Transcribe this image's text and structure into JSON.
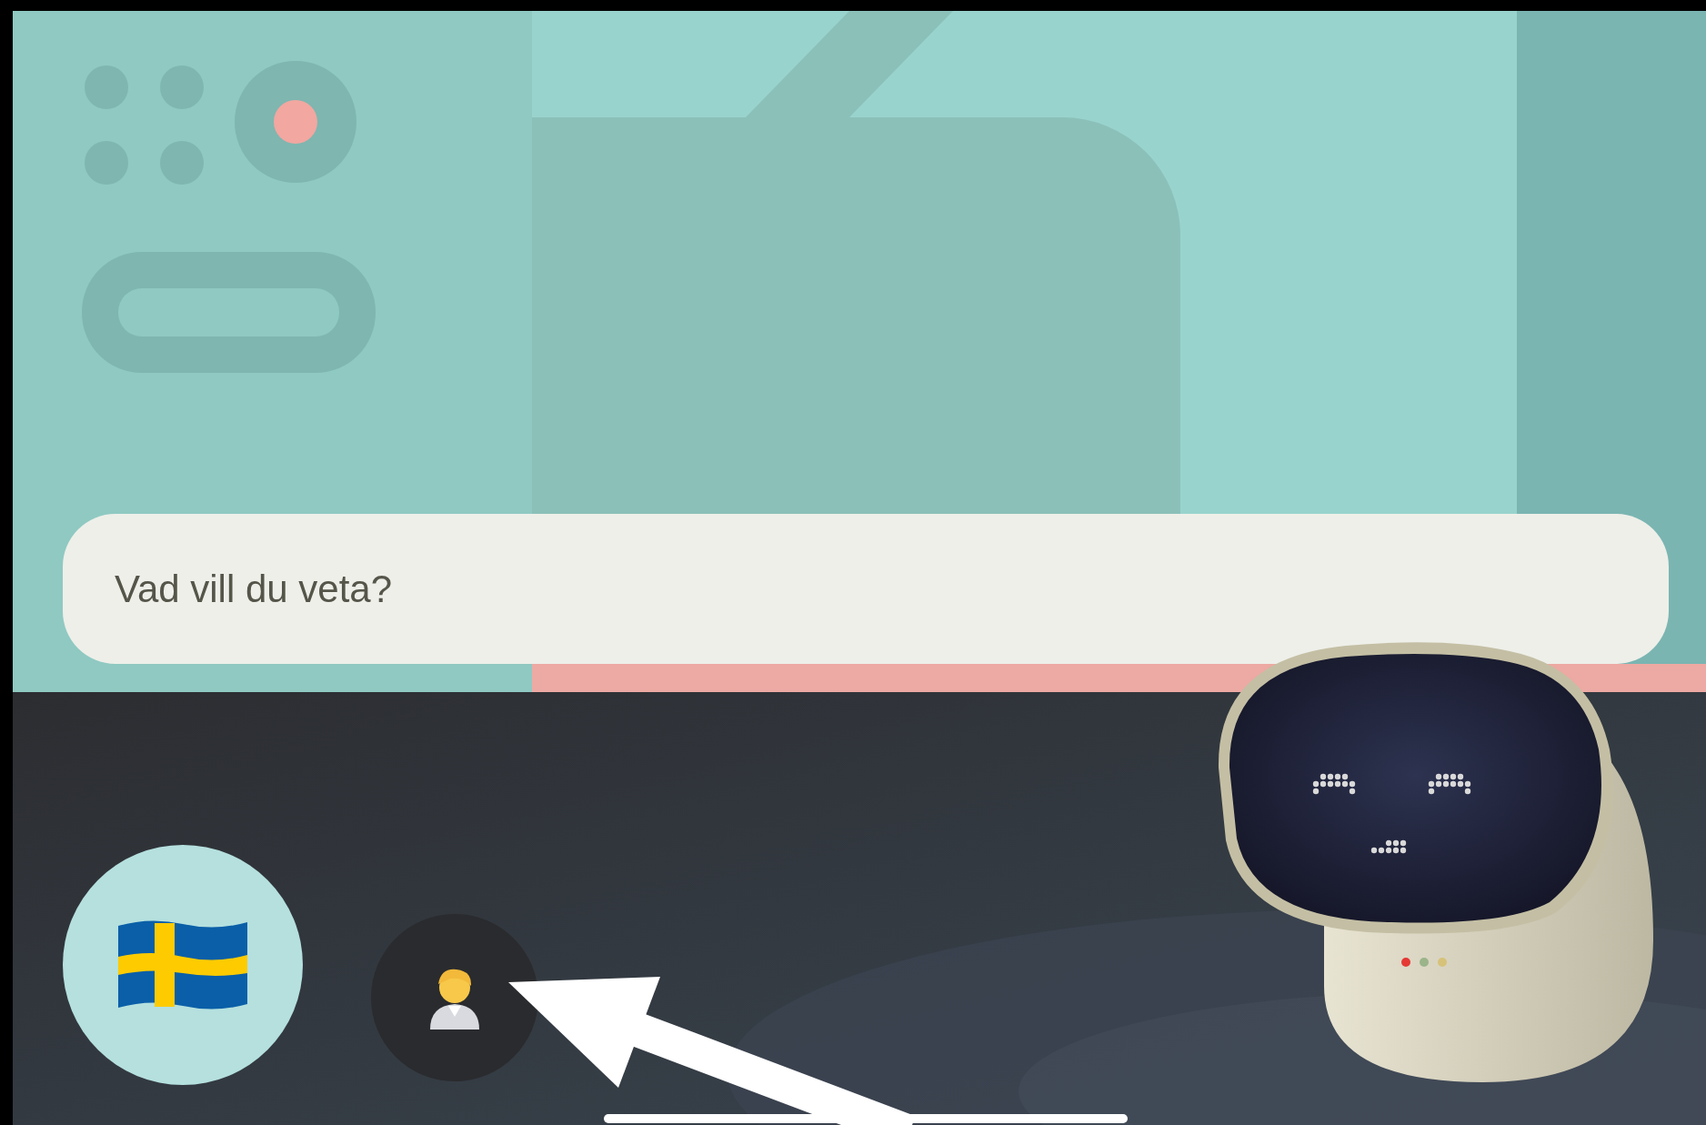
{
  "prompt_field": {
    "placeholder": "Vad vill du veta?"
  }
}
